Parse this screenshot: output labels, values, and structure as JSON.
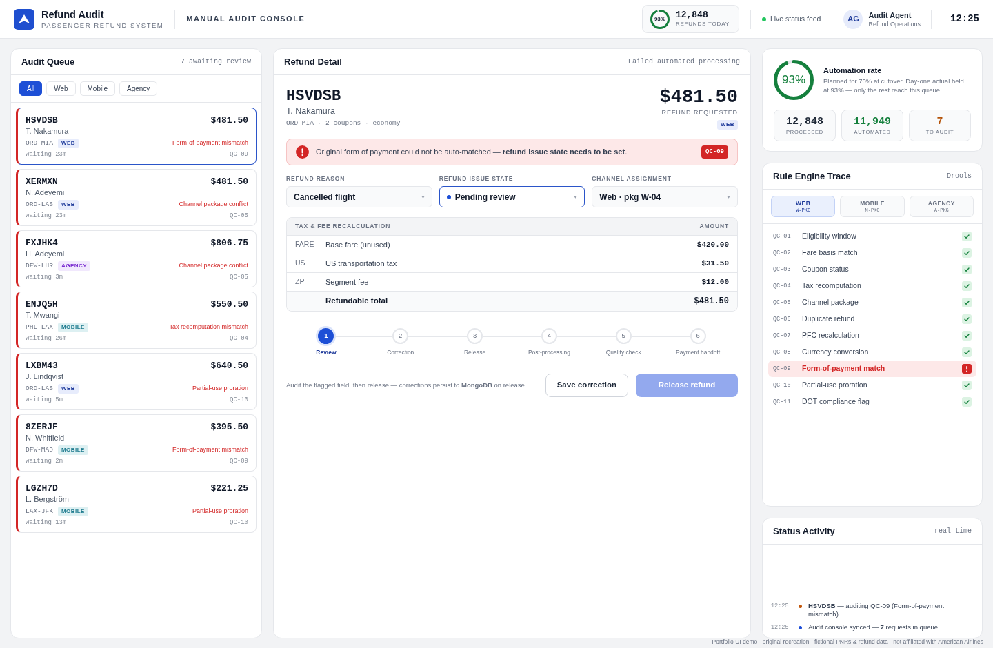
{
  "header": {
    "app_title": "Refund Audit",
    "app_subtitle": "PASSENGER REFUND SYSTEM",
    "console_title": "MANUAL AUDIT CONSOLE",
    "refunds_today": {
      "ring_label": "93%",
      "level": 0.93,
      "value": "12,848",
      "label": "REFUNDS TODAY"
    },
    "live_feed": "Live status feed",
    "user": {
      "initials": "AG",
      "name": "Audit Agent",
      "role": "Refund Operations"
    },
    "clock": "12:25"
  },
  "audit_queue": {
    "title": "Audit Queue",
    "count": "7 awaiting review",
    "filters": [
      {
        "label": "All",
        "selected": true
      },
      {
        "label": "Web",
        "selected": false
      },
      {
        "label": "Mobile",
        "selected": false
      },
      {
        "label": "Agency",
        "selected": false
      }
    ],
    "items": [
      {
        "code": "HSVDSB",
        "amount": "$481.50",
        "name": "T. Nakamura",
        "route": "ORD-MIA",
        "channel": {
          "label": "WEB",
          "kind": "web"
        },
        "issue": "Form-of-payment mismatch",
        "waiting": "waiting 23m",
        "rule": "QC-09",
        "selected": true
      },
      {
        "code": "XERMXN",
        "amount": "$481.50",
        "name": "N. Adeyemi",
        "route": "ORD-LAS",
        "channel": {
          "label": "WEB",
          "kind": "web"
        },
        "issue": "Channel package conflict",
        "waiting": "waiting 23m",
        "rule": "QC-05",
        "selected": false
      },
      {
        "code": "FXJHK4",
        "amount": "$806.75",
        "name": "H. Adeyemi",
        "route": "DFW-LHR",
        "channel": {
          "label": "AGENCY",
          "kind": "agency"
        },
        "issue": "Channel package conflict",
        "waiting": "waiting 3m",
        "rule": "QC-05",
        "selected": false
      },
      {
        "code": "ENJQ5H",
        "amount": "$550.50",
        "name": "T. Mwangi",
        "route": "PHL-LAX",
        "channel": {
          "label": "MOBILE",
          "kind": "mobile"
        },
        "issue": "Tax recomputation mismatch",
        "waiting": "waiting 26m",
        "rule": "QC-04",
        "selected": false
      },
      {
        "code": "LXBM43",
        "amount": "$640.50",
        "name": "J. Lindqvist",
        "route": "ORD-LAS",
        "channel": {
          "label": "WEB",
          "kind": "web"
        },
        "issue": "Partial-use proration",
        "waiting": "waiting 5m",
        "rule": "QC-10",
        "selected": false
      },
      {
        "code": "8ZERJF",
        "amount": "$395.50",
        "name": "N. Whitfield",
        "route": "DFW-MAD",
        "channel": {
          "label": "MOBILE",
          "kind": "mobile"
        },
        "issue": "Form-of-payment mismatch",
        "waiting": "waiting 2m",
        "rule": "QC-09",
        "selected": false
      },
      {
        "code": "LGZH7D",
        "amount": "$221.25",
        "name": "L. Bergström",
        "route": "LAX-JFK",
        "channel": {
          "label": "MOBILE",
          "kind": "mobile"
        },
        "issue": "Partial-use proration",
        "waiting": "waiting 13m",
        "rule": "QC-10",
        "selected": false
      }
    ]
  },
  "refund_detail": {
    "title": "Refund Detail",
    "status": "Failed automated processing",
    "pnr": "HSVDSB",
    "passenger": "T. Nakamura",
    "meta": "ORD-MIA · 2 coupons · economy",
    "amount": "$481.50",
    "amount_label": "REFUND REQUESTED",
    "channel": {
      "label": "WEB",
      "kind": "web"
    },
    "alert": {
      "text": "Original form of payment could not be auto-matched — **refund issue state needs to be set**.",
      "rule": "QC-09"
    },
    "fields": [
      {
        "label": "REFUND REASON",
        "value": "Cancelled flight",
        "kind": "plain",
        "focused": false
      },
      {
        "label": "REFUND ISSUE STATE",
        "value": "Pending review",
        "kind": "status",
        "focused": true
      },
      {
        "label": "CHANNEL ASSIGNMENT",
        "value": "Web · pkg W-04",
        "kind": "plain",
        "focused": false
      }
    ],
    "recalculation": {
      "columns": [
        "TAX & FEE RECALCULATION",
        "AMOUNT"
      ],
      "rows": [
        {
          "code": "FARE",
          "description": "Base fare (unused)",
          "amount": "$420.00"
        },
        {
          "code": "US",
          "description": "US transportation tax",
          "amount": "$31.50"
        },
        {
          "code": "ZP",
          "description": "Segment fee",
          "amount": "$12.00"
        }
      ],
      "total": {
        "label": "Refundable total",
        "amount": "$481.50"
      }
    },
    "steps": [
      {
        "number": "1",
        "label": "Review",
        "selected": true
      },
      {
        "number": "2",
        "label": "Correction",
        "selected": false
      },
      {
        "number": "3",
        "label": "Release",
        "selected": false
      },
      {
        "number": "4",
        "label": "Post-processing",
        "selected": false
      },
      {
        "number": "5",
        "label": "Quality check",
        "selected": false
      },
      {
        "number": "6",
        "label": "Payment handoff",
        "selected": false
      }
    ],
    "note": "Audit the flagged field, then release — corrections persist to **MongoDB** on release.",
    "buttons": [
      {
        "label": "Save correction",
        "kind": "secondary",
        "disabled": false
      },
      {
        "label": "Release refund",
        "kind": "primary",
        "disabled": true
      }
    ]
  },
  "automation": {
    "ring_label": "93%",
    "level": 0.93,
    "title": "Automation rate",
    "description": "Planned for 70% at cutover. Day-one actual held at 93% — only the rest reach this queue.",
    "stats": [
      {
        "value": "12,848",
        "label": "PROCESSED",
        "color": "#1f2937"
      },
      {
        "value": "11,949",
        "label": "AUTOMATED",
        "color": "#15803d"
      },
      {
        "value": "7",
        "label": "TO AUDIT",
        "color": "#b45309"
      }
    ]
  },
  "rule_trace": {
    "title": "Rule Engine Trace",
    "engine": "Drools",
    "tabs": [
      {
        "label": "WEB",
        "sublabel": "W-PKG",
        "selected": true
      },
      {
        "label": "MOBILE",
        "sublabel": "M-PKG",
        "selected": false
      },
      {
        "label": "AGENCY",
        "sublabel": "A-PKG",
        "selected": false
      }
    ],
    "rules": [
      {
        "code": "QC-01",
        "name": "Eligibility window",
        "passed": true
      },
      {
        "code": "QC-02",
        "name": "Fare basis match",
        "passed": true
      },
      {
        "code": "QC-03",
        "name": "Coupon status",
        "passed": true
      },
      {
        "code": "QC-04",
        "name": "Tax recomputation",
        "passed": true
      },
      {
        "code": "QC-05",
        "name": "Channel package",
        "passed": true
      },
      {
        "code": "QC-06",
        "name": "Duplicate refund",
        "passed": true
      },
      {
        "code": "QC-07",
        "name": "PFC recalculation",
        "passed": true
      },
      {
        "code": "QC-08",
        "name": "Currency conversion",
        "passed": true
      },
      {
        "code": "QC-09",
        "name": "Form-of-payment match",
        "passed": false
      },
      {
        "code": "QC-10",
        "name": "Partial-use proration",
        "passed": true
      },
      {
        "code": "QC-11",
        "name": "DOT compliance flag",
        "passed": true
      }
    ]
  },
  "status_activity": {
    "title": "Status Activity",
    "mode": "real-time",
    "events": [
      {
        "time": "12:25",
        "text": "**HSVDSB** — auditing QC-09 (Form-of-payment mismatch).",
        "color": "#c2570c"
      },
      {
        "time": "12:25",
        "text": "Audit console synced — **7** requests in queue.",
        "color": "#1d4ed8"
      }
    ]
  },
  "footer": "Portfolio UI demo · original recreation · fictional PNRs & refund data · not affiliated with American Airlines"
}
